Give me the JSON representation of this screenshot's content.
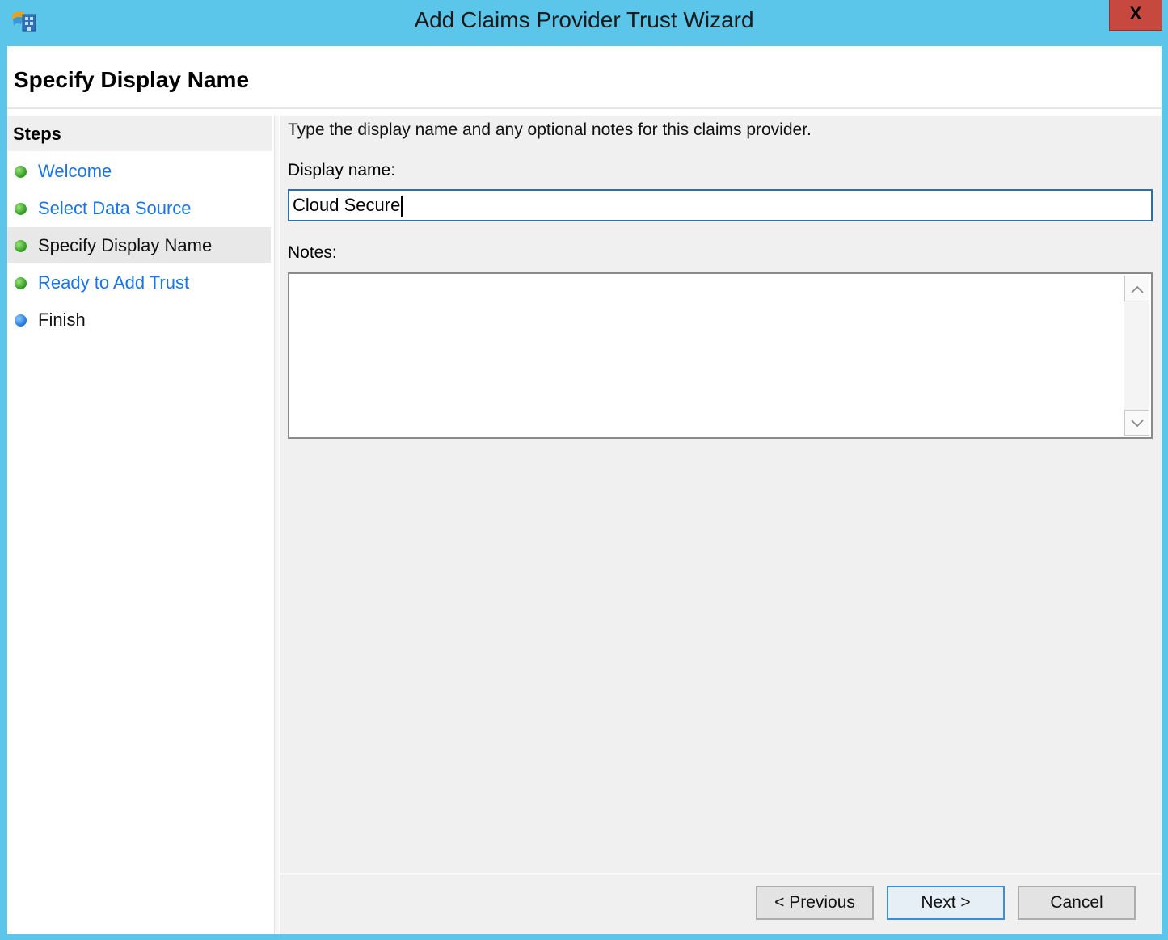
{
  "window": {
    "title": "Add Claims Provider Trust Wizard",
    "close_label": "X",
    "icon": "adfs-icon"
  },
  "page": {
    "title": "Specify Display Name"
  },
  "steps": {
    "heading": "Steps",
    "items": [
      {
        "label": "Welcome",
        "status": "completed",
        "link": true
      },
      {
        "label": "Select Data Source",
        "status": "completed",
        "link": true
      },
      {
        "label": "Specify Display Name",
        "status": "current",
        "link": false
      },
      {
        "label": "Ready to Add Trust",
        "status": "completed",
        "link": true
      },
      {
        "label": "Finish",
        "status": "pending",
        "link": false
      }
    ]
  },
  "form": {
    "instructions": "Type the display name and any optional notes for this claims provider.",
    "display_name_label": "Display name:",
    "display_name_value": "Cloud Secure",
    "notes_label": "Notes:",
    "notes_value": ""
  },
  "buttons": {
    "previous": "< Previous",
    "next": "Next >",
    "cancel": "Cancel"
  },
  "colors": {
    "titlebar": "#5bc6ea",
    "close_button": "#c7483f",
    "link": "#1a73e8",
    "step_completed": "#3aa22a",
    "step_pending": "#2c7fe0"
  }
}
